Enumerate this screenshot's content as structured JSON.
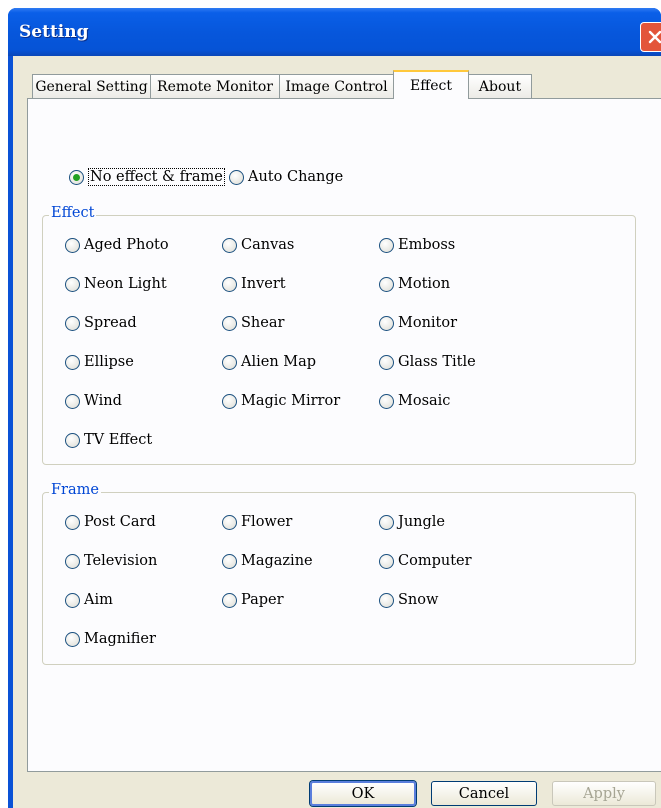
{
  "window": {
    "title": "Setting",
    "close_icon": "close-icon"
  },
  "tabs": [
    {
      "label": "General Setting",
      "active": false
    },
    {
      "label": "Remote Monitor",
      "active": false
    },
    {
      "label": "Image Control",
      "active": false
    },
    {
      "label": "Effect",
      "active": true
    },
    {
      "label": "About",
      "active": false
    }
  ],
  "mode": {
    "no_effect": {
      "label": "No effect & frame",
      "selected": true
    },
    "auto_change": {
      "label": "Auto Change",
      "selected": false
    }
  },
  "effect_group": {
    "label": "Effect",
    "options": [
      "Aged Photo",
      "Canvas",
      "Emboss",
      "Neon Light",
      "Invert",
      "Motion",
      "Spread",
      "Shear",
      "Monitor",
      "Ellipse",
      "Alien Map",
      "Glass Title",
      "Wind",
      "Magic Mirror",
      "Mosaic",
      "TV Effect"
    ]
  },
  "frame_group": {
    "label": "Frame",
    "options": [
      "Post Card",
      "Flower",
      "Jungle",
      "Television",
      "Magazine",
      "Computer",
      "Aim",
      "Paper",
      "Snow",
      "Magnifier"
    ]
  },
  "buttons": {
    "ok": "OK",
    "cancel": "Cancel",
    "apply": "Apply"
  },
  "colors": {
    "titlebar": "#0653d6",
    "dialog_bg": "#ece9d8",
    "group_label": "#0046d5",
    "selected_radio": "#21a121"
  }
}
